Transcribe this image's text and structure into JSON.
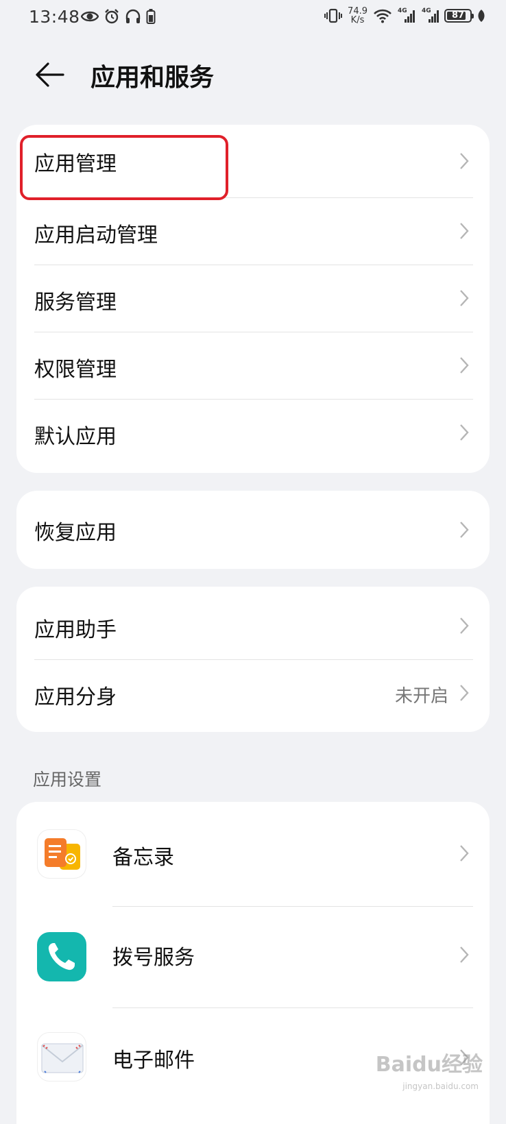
{
  "status_bar": {
    "time": "13:48",
    "speed_value": "74.9",
    "speed_unit": "K/s",
    "signal1_tag": "4G",
    "signal2_tag": "4G",
    "battery": "87",
    "battery_level": 0.87
  },
  "header": {
    "title": "应用和服务"
  },
  "group1": {
    "items": [
      {
        "label": "应用管理"
      },
      {
        "label": "应用启动管理"
      },
      {
        "label": "服务管理"
      },
      {
        "label": "权限管理"
      },
      {
        "label": "默认应用"
      }
    ]
  },
  "group2": {
    "items": [
      {
        "label": "恢复应用"
      }
    ]
  },
  "group3": {
    "items": [
      {
        "label": "应用助手"
      },
      {
        "label": "应用分身",
        "value": "未开启"
      }
    ]
  },
  "app_settings": {
    "section_title": "应用设置",
    "apps": [
      {
        "label": "备忘录",
        "icon": "memo-icon"
      },
      {
        "label": "拨号服务",
        "icon": "phone-icon"
      },
      {
        "label": "电子邮件",
        "icon": "email-icon"
      }
    ]
  },
  "colors": {
    "background": "#f1f2f5",
    "card": "#ffffff",
    "highlight": "#e0202a",
    "dial_teal": "#14b7ae",
    "memo_orange": "#f47c2a",
    "memo_yellow": "#f7b500"
  },
  "watermark": {
    "main": "Baidu经验",
    "sub": "jingyan.baidu.com"
  }
}
